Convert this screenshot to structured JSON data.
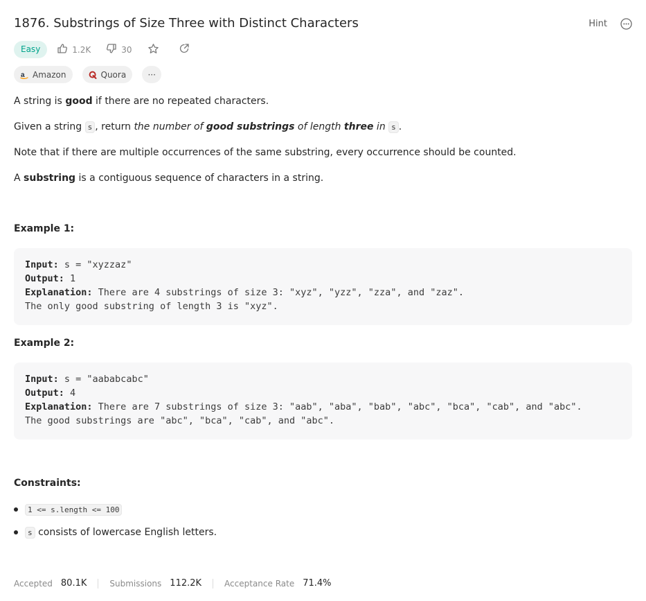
{
  "problem": {
    "title": "1876. Substrings of Size Three with Distinct Characters",
    "hint_label": "Hint",
    "difficulty": "Easy",
    "likes": "1.2K",
    "dislikes": "30"
  },
  "companies": [
    {
      "name": "Amazon",
      "icon": "amazon-icon"
    },
    {
      "name": "Quora",
      "icon": "quora-icon"
    }
  ],
  "more_tags_label": "···",
  "description": {
    "p1_a": "A string is ",
    "p1_b": "good",
    "p1_c": " if there are no repeated characters.",
    "p2_a": "Given a string ",
    "p2_code1": "s",
    "p2_b": ", return ",
    "p2_c": "the number of ",
    "p2_d": "good substrings",
    "p2_e": " of length ",
    "p2_f": "three",
    "p2_g": " in ",
    "p2_code2": "s",
    "p2_h": ".",
    "p3": "Note that if there are multiple occurrences of the same substring, every occurrence should be counted.",
    "p4_a": "A ",
    "p4_b": "substring",
    "p4_c": " is a contiguous sequence of characters in a string."
  },
  "examples": [
    {
      "heading": "Example 1:",
      "input_label": "Input:",
      "input": " s = \"xyzzaz\"",
      "output_label": "Output:",
      "output": " 1",
      "explanation_label": "Explanation:",
      "explanation": " There are 4 substrings of size 3: \"xyz\", \"yzz\", \"zza\", and \"zaz\". ",
      "explanation2": "The only good substring of length 3 is \"xyz\"."
    },
    {
      "heading": "Example 2:",
      "input_label": "Input:",
      "input": " s = \"aababcabc\"",
      "output_label": "Output:",
      "output": " 4",
      "explanation_label": "Explanation:",
      "explanation": " There are 7 substrings of size 3: \"aab\", \"aba\", \"bab\", \"abc\", \"bca\", \"cab\", and \"abc\".",
      "explanation2": "The good substrings are \"abc\", \"bca\", \"cab\", and \"abc\"."
    }
  ],
  "constraints": {
    "heading": "Constraints:",
    "c1": "1 <= s.length <= 100",
    "c2_code": "s",
    "c2_text": " consists of lowercase English letters."
  },
  "stats": {
    "accepted_label": "Accepted",
    "accepted_value": "80.1K",
    "submissions_label": "Submissions",
    "submissions_value": "112.2K",
    "rate_label": "Acceptance Rate",
    "rate_value": "71.4%"
  },
  "colors": {
    "easy_bg": "#dff3ef",
    "easy_text": "#00a38b",
    "amazon": "#ff9900",
    "quora": "#b92b27"
  }
}
